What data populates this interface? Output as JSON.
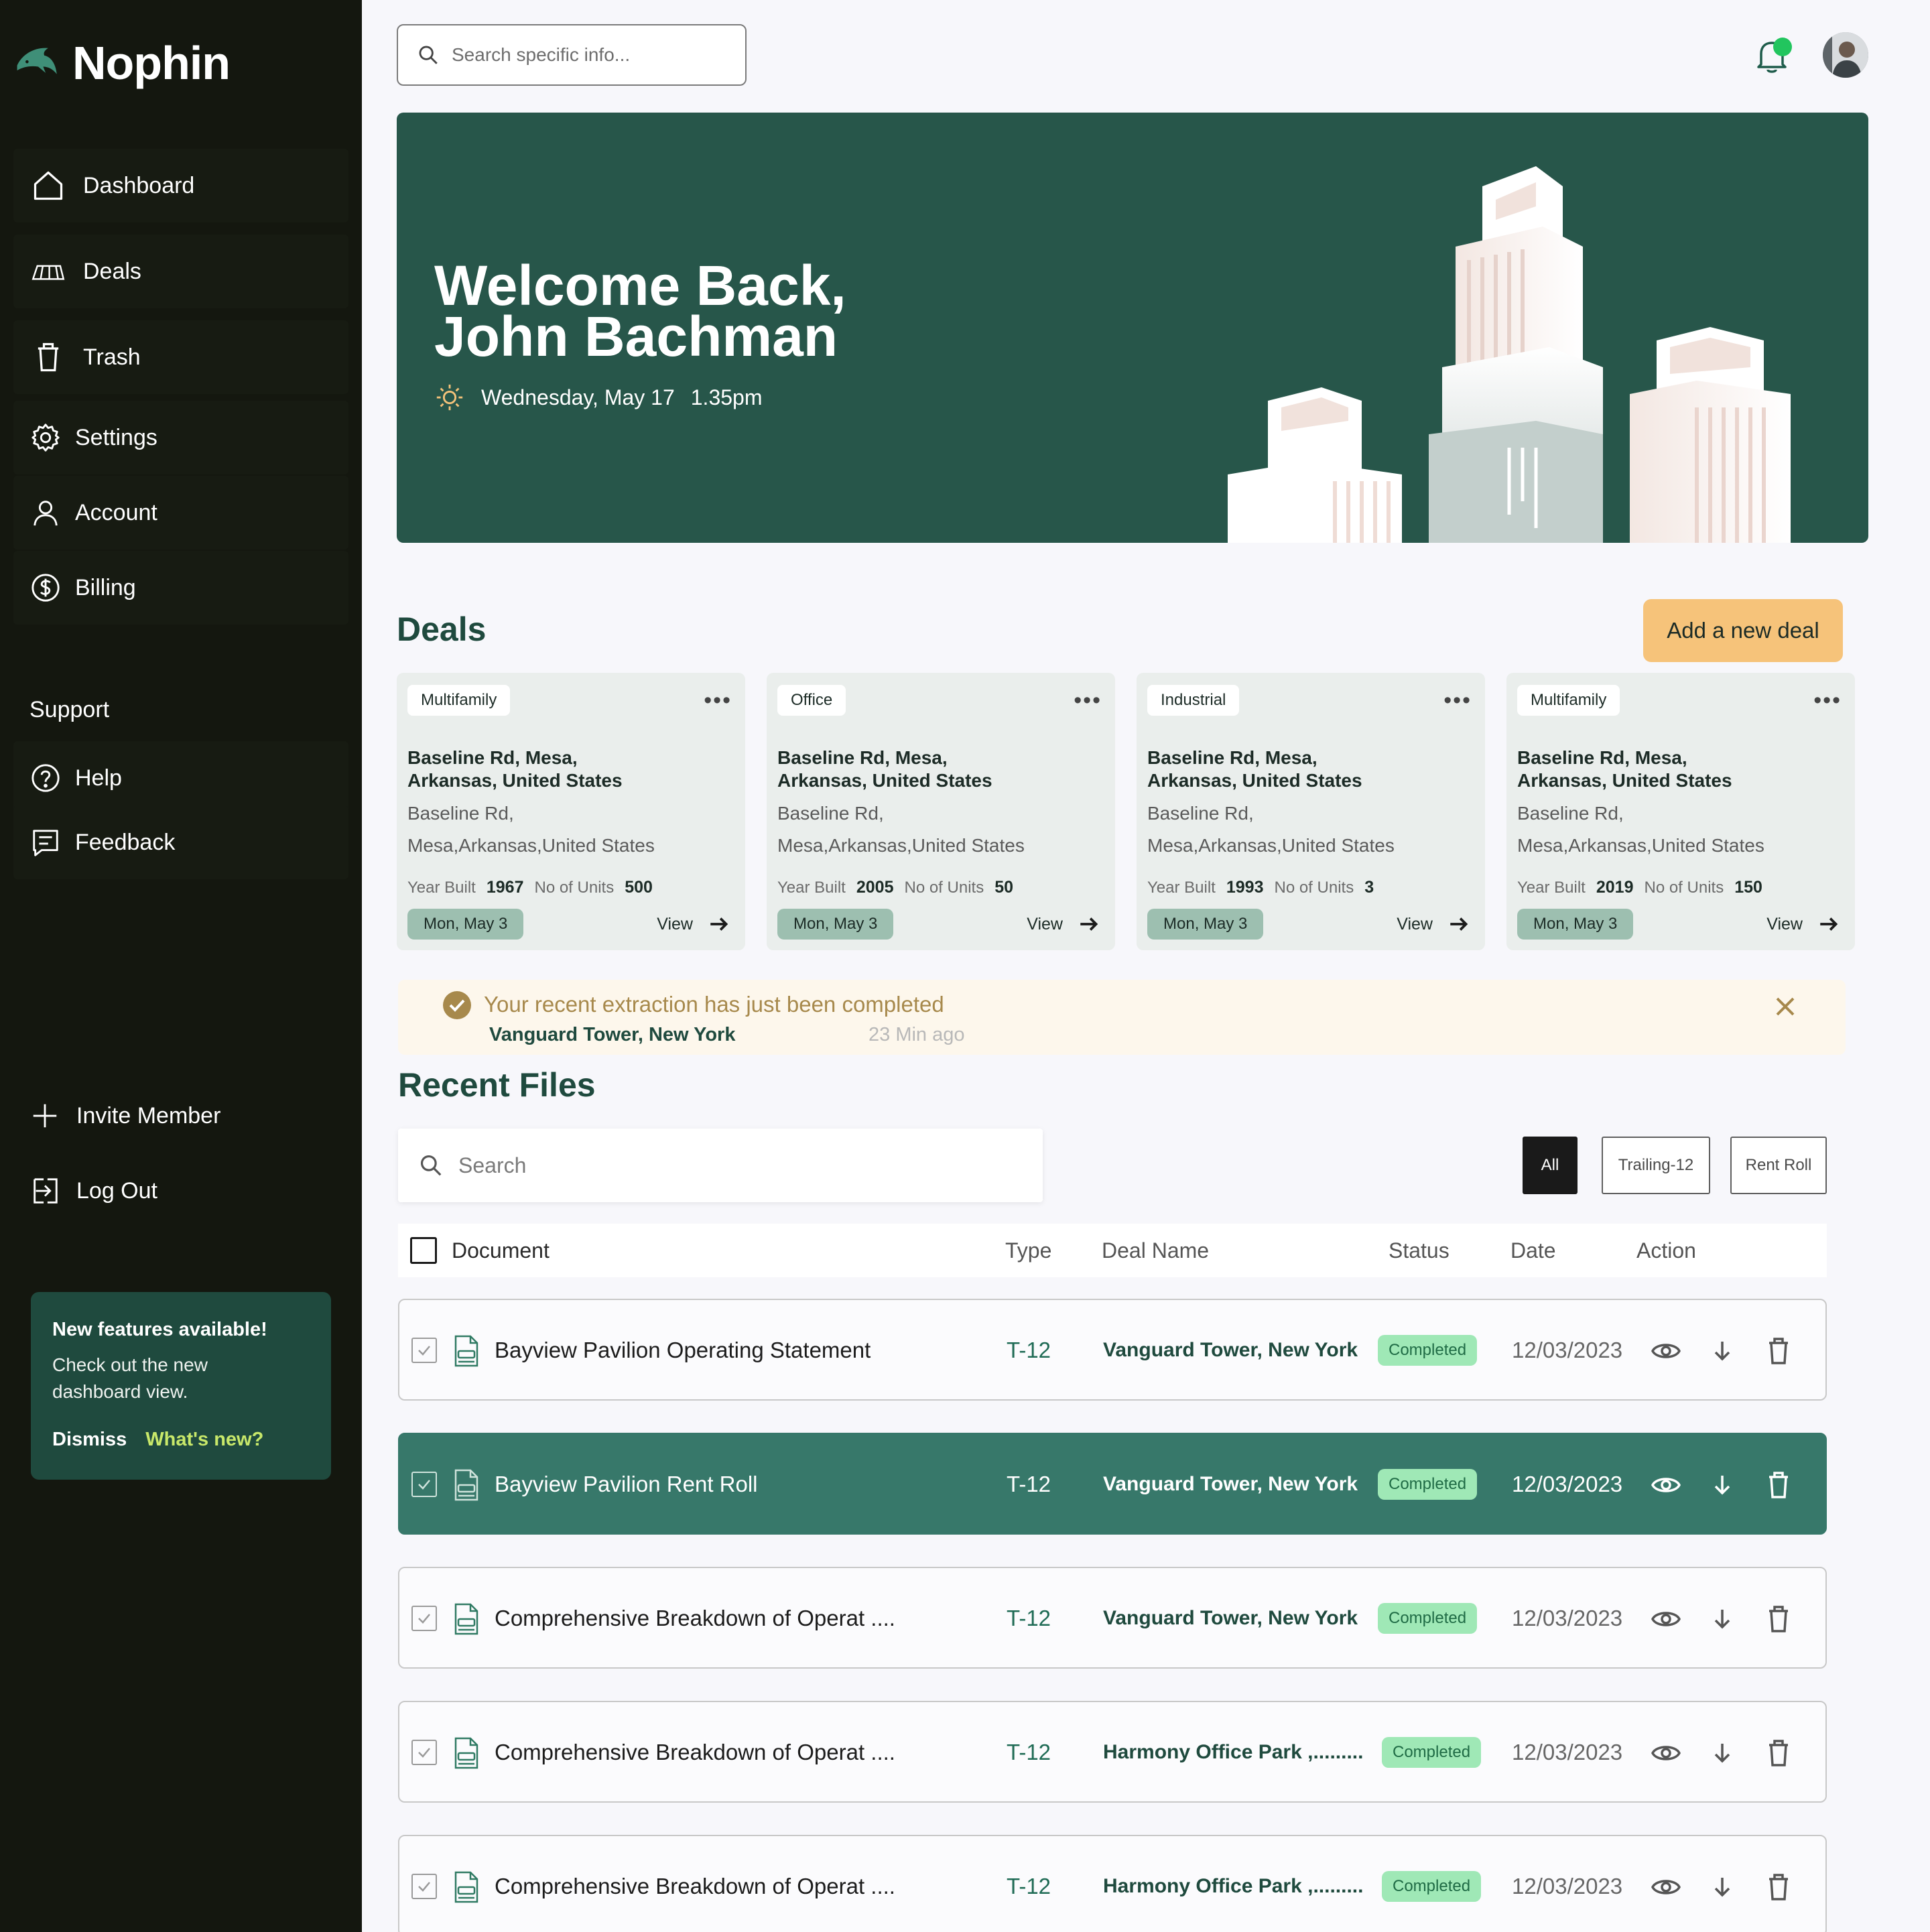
{
  "app": {
    "name": "Nophin"
  },
  "sidebar": {
    "nav": [
      {
        "label": "Dashboard",
        "icon": "home-icon"
      },
      {
        "label": "Deals",
        "icon": "deals-icon"
      },
      {
        "label": "Trash",
        "icon": "trash-icon"
      },
      {
        "label": "Settings",
        "icon": "gear-icon"
      },
      {
        "label": "Account",
        "icon": "user-icon"
      },
      {
        "label": "Billing",
        "icon": "dollar-icon"
      }
    ],
    "support_title": "Support",
    "support": [
      {
        "label": "Help",
        "icon": "help-icon"
      },
      {
        "label": "Feedback",
        "icon": "feedback-icon"
      }
    ],
    "invite_label": "Invite Member",
    "logout_label": "Log Out",
    "feature_card": {
      "title": "New features available!",
      "body": "Check out the new dashboard view.",
      "dismiss": "Dismiss",
      "whats_new": "What's new?"
    }
  },
  "header": {
    "search_placeholder": "Search specific info..."
  },
  "hero": {
    "title_line1": "Welcome Back,",
    "title_line2": "John Bachman",
    "date": "Wednesday, May 17",
    "time": "1.35pm"
  },
  "deals": {
    "title": "Deals",
    "add_label": "Add a new deal",
    "year_label": "Year Built",
    "units_label": "No of Units",
    "view_label": "View",
    "menu": "•••",
    "cards": [
      {
        "tag": "Multifamily",
        "addr1": "Baseline Rd,  Mesa,",
        "addr2": "Arkansas, United States",
        "sub1": "Baseline Rd,",
        "sub2": "Mesa,Arkansas,United States",
        "year": "1967",
        "units": "500",
        "date": "Mon, May 3"
      },
      {
        "tag": "Office",
        "addr1": "Baseline Rd,  Mesa,",
        "addr2": "Arkansas, United States",
        "sub1": "Baseline Rd,",
        "sub2": "Mesa,Arkansas,United States",
        "year": "2005",
        "units": "50",
        "date": "Mon, May 3"
      },
      {
        "tag": "Industrial",
        "addr1": "Baseline Rd,  Mesa,",
        "addr2": "Arkansas, United States",
        "sub1": "Baseline Rd,",
        "sub2": "Mesa,Arkansas,United States",
        "year": "1993",
        "units": "3",
        "date": "Mon, May 3"
      },
      {
        "tag": "Multifamily",
        "addr1": "Baseline Rd,  Mesa,",
        "addr2": "Arkansas, United States",
        "sub1": "Baseline Rd,",
        "sub2": "Mesa,Arkansas,United States",
        "year": "2019",
        "units": "150",
        "date": "Mon, May 3"
      }
    ]
  },
  "notification": {
    "title": "Your recent extraction has just been completed",
    "deal": "Vanguard Tower, New York",
    "time": "23 Min ago"
  },
  "files": {
    "title": "Recent Files",
    "search_placeholder": "Search",
    "filters": [
      "All",
      "Trailing-12",
      "Rent Roll"
    ],
    "columns": [
      "Document",
      "Type",
      "Deal Name",
      "Status",
      "Date",
      "Action"
    ],
    "rows": [
      {
        "doc": "Bayview Pavilion Operating Statement",
        "type": "T-12",
        "deal": "Vanguard Tower, New York",
        "status": "Completed",
        "date": "12/03/2023"
      },
      {
        "doc": "Bayview Pavilion Rent Roll",
        "type": "T-12",
        "deal": "Vanguard Tower, New York",
        "status": "Completed",
        "date": "12/03/2023"
      },
      {
        "doc": "Comprehensive Breakdown of Operat ....",
        "type": "T-12",
        "deal": "Vanguard Tower, New York",
        "status": "Completed",
        "date": "12/03/2023"
      },
      {
        "doc": "Comprehensive Breakdown of Operat ....",
        "type": "T-12",
        "deal": "Harmony Office Park ,.........",
        "status": "Completed",
        "date": "12/03/2023"
      },
      {
        "doc": "Comprehensive Breakdown of Operat ....",
        "type": "T-12",
        "deal": "Harmony Office Park ,.........",
        "status": "Completed",
        "date": "12/03/2023"
      }
    ]
  },
  "colors": {
    "sidebar": "#14170f",
    "brand_green": "#27564a",
    "selected_row": "#37786a",
    "accent_orange": "#f6c37a",
    "status_green": "#9fe8b6"
  }
}
